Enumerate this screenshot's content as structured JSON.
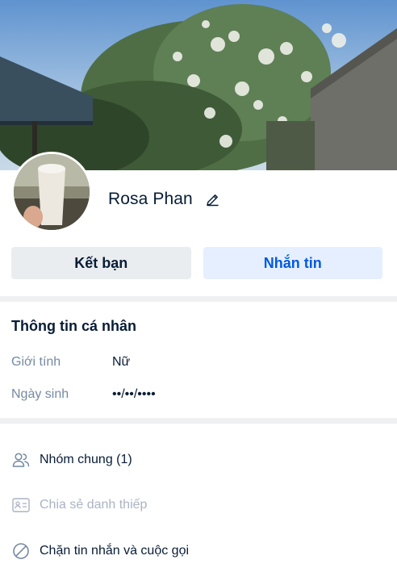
{
  "profile": {
    "name": "Rosa Phan"
  },
  "actions": {
    "add_friend_label": "Kết bạn",
    "message_label": "Nhắn tin"
  },
  "personal_info": {
    "title": "Thông tin cá nhân",
    "rows": [
      {
        "label": "Giới tính",
        "value": "Nữ"
      },
      {
        "label": "Ngày sinh",
        "value": "••/••/••••"
      }
    ]
  },
  "menu": [
    {
      "label": "Nhóm chung (1)",
      "icon": "users-icon",
      "enabled": true
    },
    {
      "label": "Chia sẻ danh thiếp",
      "icon": "contact-card-icon",
      "enabled": false
    },
    {
      "label": "Chặn tin nhắn và cuộc gọi",
      "icon": "block-icon",
      "enabled": true
    }
  ],
  "colors": {
    "primary": "#005ae0",
    "primary_bg": "#e5efff",
    "secondary_bg": "#eaedf0",
    "text": "#081c36",
    "muted": "#7589a3",
    "divider": "#eef0f1"
  }
}
